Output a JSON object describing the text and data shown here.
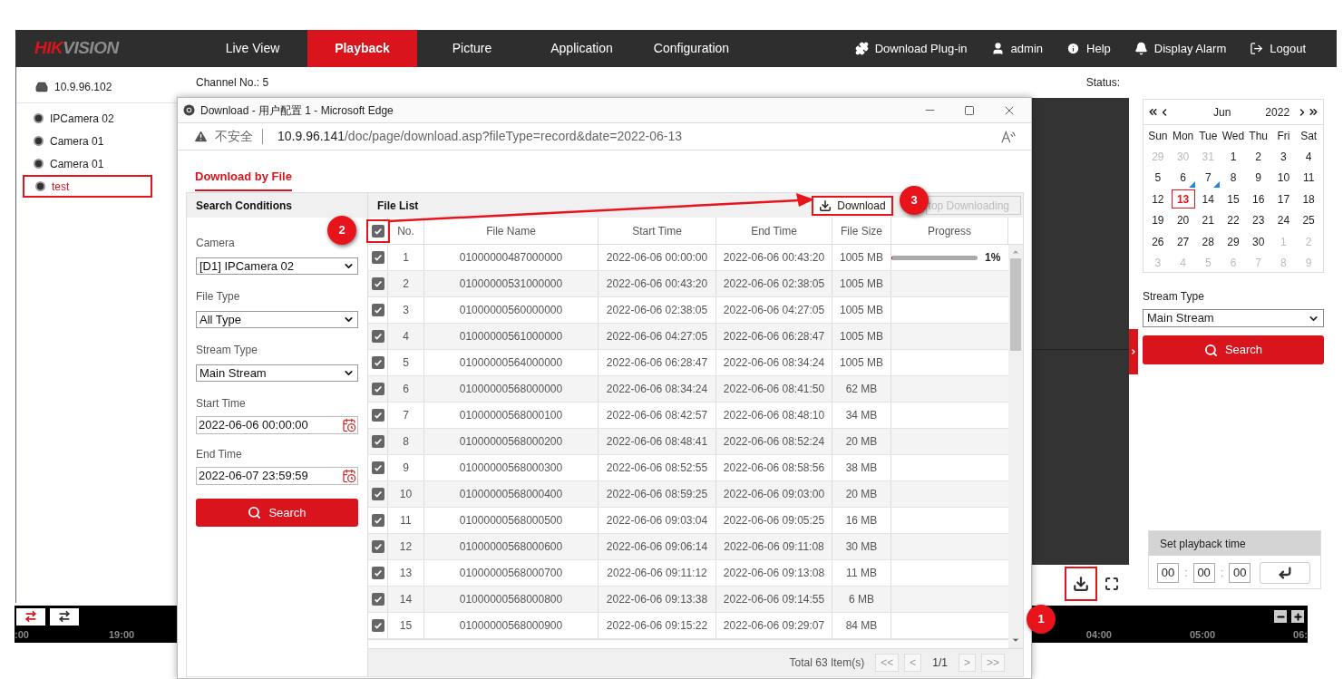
{
  "nav": {
    "logo_accent": "HIK",
    "logo_rest": "VISION",
    "tabs": [
      {
        "label": "Live View",
        "selected": false
      },
      {
        "label": "Playback",
        "selected": true
      },
      {
        "label": "Picture",
        "selected": false
      },
      {
        "label": "Application",
        "selected": false
      },
      {
        "label": "Configuration",
        "selected": false
      }
    ],
    "actions": [
      {
        "kind": "plugin",
        "label": "Download Plug-in"
      },
      {
        "kind": "user",
        "label": "admin"
      },
      {
        "kind": "help",
        "label": "Help"
      },
      {
        "kind": "alarm",
        "label": "Display Alarm"
      },
      {
        "kind": "logout",
        "label": "Logout"
      }
    ]
  },
  "device_tree": {
    "device": "10.9.96.102",
    "cameras": [
      {
        "label": "IPCamera 02",
        "selected": false,
        "highlighted": false
      },
      {
        "label": "Camera 01",
        "selected": false,
        "highlighted": false
      },
      {
        "label": "Camera 01",
        "selected": false,
        "highlighted": false
      },
      {
        "label": "test",
        "selected": true,
        "highlighted": true
      }
    ]
  },
  "channel_label": "Channel No.: 5",
  "status_label": "Status:",
  "player_toolbar": {
    "download_highlighted": true
  },
  "timeline": {
    "tools": [
      {
        "selected": true
      },
      {
        "selected": false
      }
    ],
    "ticks_left": [
      ":00",
      "19:00"
    ],
    "ticks_right": [
      "04:00",
      "05:00",
      "06:"
    ]
  },
  "calendar": {
    "month": "Jun",
    "year": "2022",
    "weekdays": [
      "Sun",
      "Mon",
      "Tue",
      "Wed",
      "Thu",
      "Fri",
      "Sat"
    ],
    "days": [
      {
        "label": "29",
        "muted": true,
        "record": false,
        "selected": false
      },
      {
        "label": "30",
        "muted": true,
        "record": false,
        "selected": false
      },
      {
        "label": "31",
        "muted": true,
        "record": false,
        "selected": false
      },
      {
        "label": "1",
        "muted": false,
        "record": false,
        "selected": false
      },
      {
        "label": "2",
        "muted": false,
        "record": false,
        "selected": false
      },
      {
        "label": "3",
        "muted": false,
        "record": false,
        "selected": false
      },
      {
        "label": "4",
        "muted": false,
        "record": false,
        "selected": false
      },
      {
        "label": "5",
        "muted": false,
        "record": false,
        "selected": false
      },
      {
        "label": "6",
        "muted": false,
        "record": true,
        "selected": false
      },
      {
        "label": "7",
        "muted": false,
        "record": true,
        "selected": false
      },
      {
        "label": "8",
        "muted": false,
        "record": false,
        "selected": false
      },
      {
        "label": "9",
        "muted": false,
        "record": false,
        "selected": false
      },
      {
        "label": "10",
        "muted": false,
        "record": false,
        "selected": false
      },
      {
        "label": "11",
        "muted": false,
        "record": false,
        "selected": false
      },
      {
        "label": "12",
        "muted": false,
        "record": false,
        "selected": false
      },
      {
        "label": "13",
        "muted": false,
        "record": false,
        "selected": true
      },
      {
        "label": "14",
        "muted": false,
        "record": false,
        "selected": false
      },
      {
        "label": "15",
        "muted": false,
        "record": false,
        "selected": false
      },
      {
        "label": "16",
        "muted": false,
        "record": false,
        "selected": false
      },
      {
        "label": "17",
        "muted": false,
        "record": false,
        "selected": false
      },
      {
        "label": "18",
        "muted": false,
        "record": false,
        "selected": false
      },
      {
        "label": "19",
        "muted": false,
        "record": false,
        "selected": false
      },
      {
        "label": "20",
        "muted": false,
        "record": false,
        "selected": false
      },
      {
        "label": "21",
        "muted": false,
        "record": false,
        "selected": false
      },
      {
        "label": "22",
        "muted": false,
        "record": false,
        "selected": false
      },
      {
        "label": "23",
        "muted": false,
        "record": false,
        "selected": false
      },
      {
        "label": "24",
        "muted": false,
        "record": false,
        "selected": false
      },
      {
        "label": "25",
        "muted": false,
        "record": false,
        "selected": false
      },
      {
        "label": "26",
        "muted": false,
        "record": false,
        "selected": false
      },
      {
        "label": "27",
        "muted": false,
        "record": false,
        "selected": false
      },
      {
        "label": "28",
        "muted": false,
        "record": false,
        "selected": false
      },
      {
        "label": "29",
        "muted": false,
        "record": false,
        "selected": false
      },
      {
        "label": "30",
        "muted": false,
        "record": false,
        "selected": false
      },
      {
        "label": "1",
        "muted": true,
        "record": false,
        "selected": false
      },
      {
        "label": "2",
        "muted": true,
        "record": false,
        "selected": false
      },
      {
        "label": "3",
        "muted": true,
        "record": false,
        "selected": false
      },
      {
        "label": "4",
        "muted": true,
        "record": false,
        "selected": false
      },
      {
        "label": "5",
        "muted": true,
        "record": false,
        "selected": false
      },
      {
        "label": "6",
        "muted": true,
        "record": false,
        "selected": false
      },
      {
        "label": "7",
        "muted": true,
        "record": false,
        "selected": false
      },
      {
        "label": "8",
        "muted": true,
        "record": false,
        "selected": false
      },
      {
        "label": "9",
        "muted": true,
        "record": false,
        "selected": false
      }
    ]
  },
  "stream_type": {
    "label": "Stream Type",
    "value": "Main Stream"
  },
  "search_button": "Search",
  "playback_time": {
    "title": "Set playback time",
    "hours": "00",
    "minutes": "00",
    "seconds": "00",
    "separator": ":"
  },
  "popup": {
    "title": "Download - 用户配置 1 - Microsoft Edge",
    "security": "不安全",
    "url_host": "10.9.96.141",
    "url_path": "/doc/page/download.asp?fileType=record&date=2022-06-13",
    "tab": "Download by File",
    "conditions": {
      "title": "Search Conditions",
      "fields": [
        {
          "kind": "select",
          "label": "Camera",
          "value": "[D1] IPCamera 02"
        },
        {
          "kind": "select",
          "label": "File Type",
          "value": "All Type"
        },
        {
          "kind": "select",
          "label": "Stream Type",
          "value": "Main Stream"
        },
        {
          "kind": "date",
          "label": "Start Time",
          "value": "2022-06-06 00:00:00"
        },
        {
          "kind": "date",
          "label": "End Time",
          "value": "2022-06-07 23:59:59"
        }
      ],
      "search_button": "Search"
    },
    "file_list": {
      "title": "File List",
      "download_button": "Download",
      "download_highlighted": true,
      "stop_button": "top Downloading",
      "stop_disabled": true,
      "select_all": true,
      "select_all_highlighted": true,
      "columns": [
        "No.",
        "File Name",
        "Start Time",
        "End Time",
        "File Size",
        "Progress"
      ],
      "rows": [
        {
          "no": "1",
          "file_name": "01000000487000000",
          "start": "2022-06-06 00:00:00",
          "end": "2022-06-06 00:43:20",
          "size": "1005 MB",
          "checked": true,
          "progress": {
            "level": 0.01,
            "label": "1%"
          }
        },
        {
          "no": "2",
          "file_name": "01000000531000000",
          "start": "2022-06-06 00:43:20",
          "end": "2022-06-06 02:38:05",
          "size": "1005 MB",
          "checked": true
        },
        {
          "no": "3",
          "file_name": "01000000560000000",
          "start": "2022-06-06 02:38:05",
          "end": "2022-06-06 04:27:05",
          "size": "1005 MB",
          "checked": true
        },
        {
          "no": "4",
          "file_name": "01000000561000000",
          "start": "2022-06-06 04:27:05",
          "end": "2022-06-06 06:28:47",
          "size": "1005 MB",
          "checked": true
        },
        {
          "no": "5",
          "file_name": "01000000564000000",
          "start": "2022-06-06 06:28:47",
          "end": "2022-06-06 08:34:24",
          "size": "1005 MB",
          "checked": true
        },
        {
          "no": "6",
          "file_name": "01000000568000000",
          "start": "2022-06-06 08:34:24",
          "end": "2022-06-06 08:41:50",
          "size": "62 MB",
          "checked": true
        },
        {
          "no": "7",
          "file_name": "01000000568000100",
          "start": "2022-06-06 08:42:57",
          "end": "2022-06-06 08:48:10",
          "size": "34 MB",
          "checked": true
        },
        {
          "no": "8",
          "file_name": "01000000568000200",
          "start": "2022-06-06 08:48:41",
          "end": "2022-06-06 08:52:24",
          "size": "20 MB",
          "checked": true
        },
        {
          "no": "9",
          "file_name": "01000000568000300",
          "start": "2022-06-06 08:52:55",
          "end": "2022-06-06 08:58:56",
          "size": "38 MB",
          "checked": true
        },
        {
          "no": "10",
          "file_name": "01000000568000400",
          "start": "2022-06-06 08:59:25",
          "end": "2022-06-06 09:03:00",
          "size": "20 MB",
          "checked": true
        },
        {
          "no": "11",
          "file_name": "01000000568000500",
          "start": "2022-06-06 09:03:04",
          "end": "2022-06-06 09:05:25",
          "size": "16 MB",
          "checked": true
        },
        {
          "no": "12",
          "file_name": "01000000568000600",
          "start": "2022-06-06 09:06:14",
          "end": "2022-06-06 09:11:08",
          "size": "30 MB",
          "checked": true
        },
        {
          "no": "13",
          "file_name": "01000000568000700",
          "start": "2022-06-06 09:11:12",
          "end": "2022-06-06 09:13:08",
          "size": "11 MB",
          "checked": true
        },
        {
          "no": "14",
          "file_name": "01000000568000800",
          "start": "2022-06-06 09:13:38",
          "end": "2022-06-06 09:14:55",
          "size": "6 MB",
          "checked": true
        },
        {
          "no": "15",
          "file_name": "01000000568000900",
          "start": "2022-06-06 09:15:22",
          "end": "2022-06-06 09:29:07",
          "size": "84 MB",
          "checked": true
        }
      ],
      "total": "Total 63 Item(s)",
      "pager": [
        {
          "kind": "button",
          "label": "<<"
        },
        {
          "kind": "button",
          "label": "<"
        },
        {
          "kind": "page",
          "label": "1/1"
        },
        {
          "kind": "button",
          "label": ">"
        },
        {
          "kind": "button",
          "label": ">>"
        }
      ]
    }
  },
  "annotations": [
    {
      "label": "1"
    },
    {
      "label": "2"
    },
    {
      "label": "3"
    }
  ]
}
